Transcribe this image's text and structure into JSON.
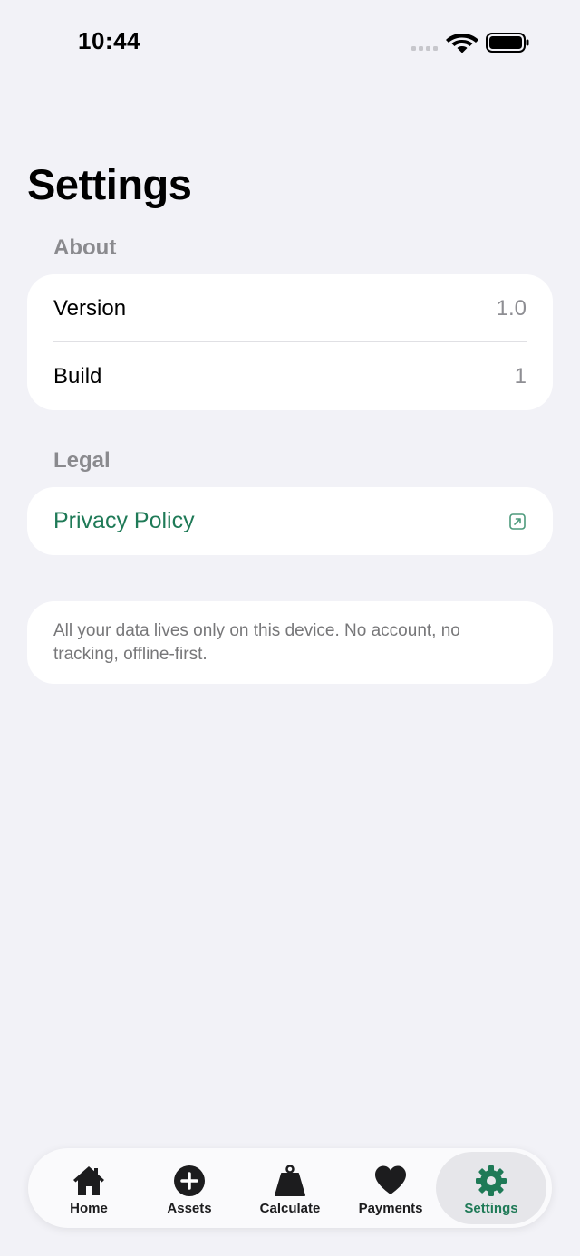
{
  "status_bar": {
    "time": "10:44",
    "icons": [
      "cellular-dots-icon",
      "wifi-icon",
      "battery-icon"
    ]
  },
  "page": {
    "title": "Settings"
  },
  "about": {
    "header": "About",
    "rows": [
      {
        "label": "Version",
        "value": "1.0"
      },
      {
        "label": "Build",
        "value": "1"
      }
    ]
  },
  "legal": {
    "header": "Legal",
    "privacy_label": "Privacy Policy",
    "link_icon": "external-link-icon"
  },
  "note": {
    "text": "All your data lives only on this device. No account, no tracking, offline-first."
  },
  "tab_bar": {
    "tabs": [
      {
        "label": "Home",
        "icon": "house-icon",
        "active": false
      },
      {
        "label": "Assets",
        "icon": "plus-circle-icon",
        "active": false
      },
      {
        "label": "Calculate",
        "icon": "scale-weight-icon",
        "active": false
      },
      {
        "label": "Payments",
        "icon": "heart-icon",
        "active": false
      },
      {
        "label": "Settings",
        "icon": "gear-icon",
        "active": true
      }
    ]
  },
  "colors": {
    "accent": "#1f7a57",
    "background": "#f2f2f7",
    "card": "#ffffff",
    "secondary_text": "#8e8e93"
  }
}
